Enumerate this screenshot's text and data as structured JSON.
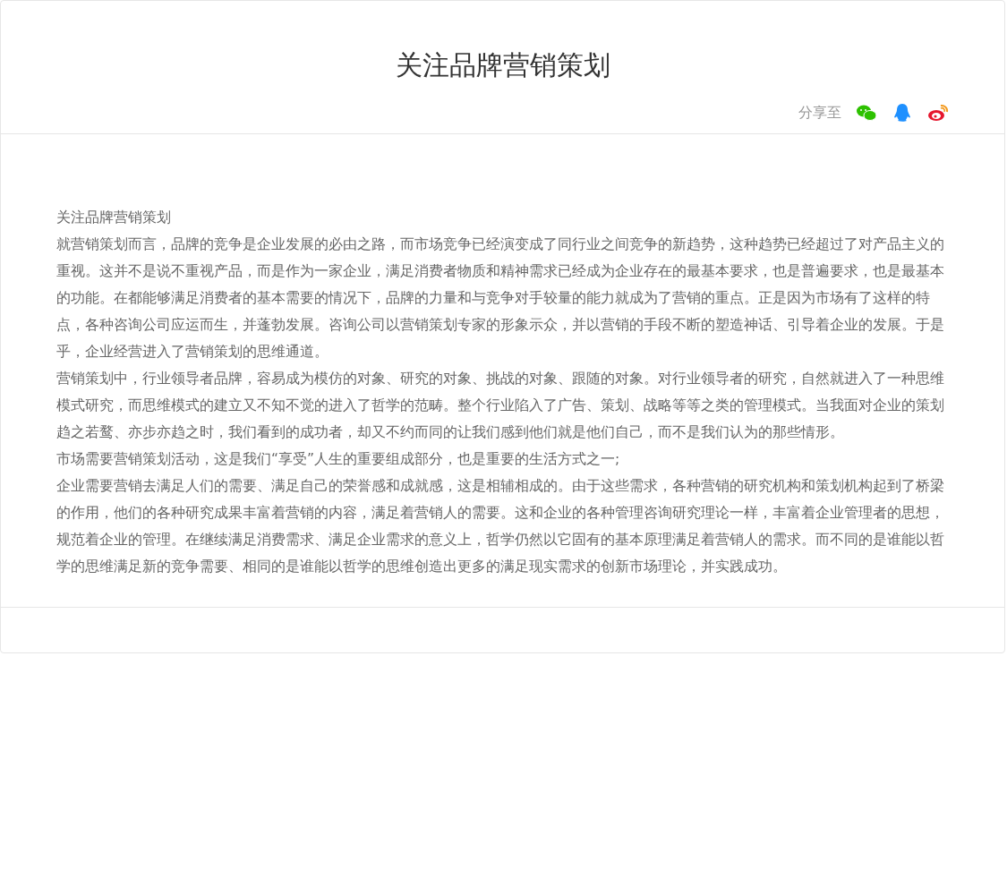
{
  "title": "关注品牌营销策划",
  "share": {
    "label": "分享至",
    "icons": [
      {
        "kind": "wechat"
      },
      {
        "kind": "qq"
      },
      {
        "kind": "weibo"
      }
    ]
  },
  "article": {
    "paragraphs": [
      "关注品牌营销策划",
      "就营销策划而言，品牌的竞争是企业发展的必由之路，而市场竞争已经演变成了同行业之间竞争的新趋势，这种趋势已经超过了对产品主义的重视。这并不是说不重视产品，而是作为一家企业，满足消费者物质和精神需求已经成为企业存在的最基本要求，也是普遍要求，也是最基本的功能。在都能够满足消费者的基本需要的情况下，品牌的力量和与竞争对手较量的能力就成为了营销的重点。正是因为市场有了这样的特点，各种咨询公司应运而生，并蓬勃发展。咨询公司以营销策划专家的形象示众，并以营销的手段不断的塑造神话、引导着企业的发展。于是乎，企业经营进入了营销策划的思维通道。",
      "营销策划中，行业领导者品牌，容易成为模仿的对象、研究的对象、挑战的对象、跟随的对象。对行业领导者的研究，自然就进入了一种思维模式研究，而思维模式的建立又不知不觉的进入了哲学的范畴。整个行业陷入了广告、策划、战略等等之类的管理模式。当我面对企业的策划趋之若鹜、亦步亦趋之时，我们看到的成功者，却又不约而同的让我们感到他们就是他们自己，而不是我们认为的那些情形。",
      "市场需要营销策划活动，这是我们“享受”人生的重要组成部分，也是重要的生活方式之一;",
      "企业需要营销去满足人们的需要、满足自己的荣誉感和成就感，这是相辅相成的。由于这些需求，各种营销的研究机构和策划机构起到了桥梁的作用，他们的各种研究成果丰富着营销的内容，满足着营销人的需要。这和企业的各种管理咨询研究理论一样，丰富着企业管理者的思想，规范着企业的管理。在继续满足消费需求、满足企业需求的意义上，哲学仍然以它固有的基本原理满足着营销人的需求。而不同的是谁能以哲学的思维满足新的竞争需要、相同的是谁能以哲学的思维创造出更多的满足现实需求的创新市场理论，并实践成功。"
    ]
  }
}
